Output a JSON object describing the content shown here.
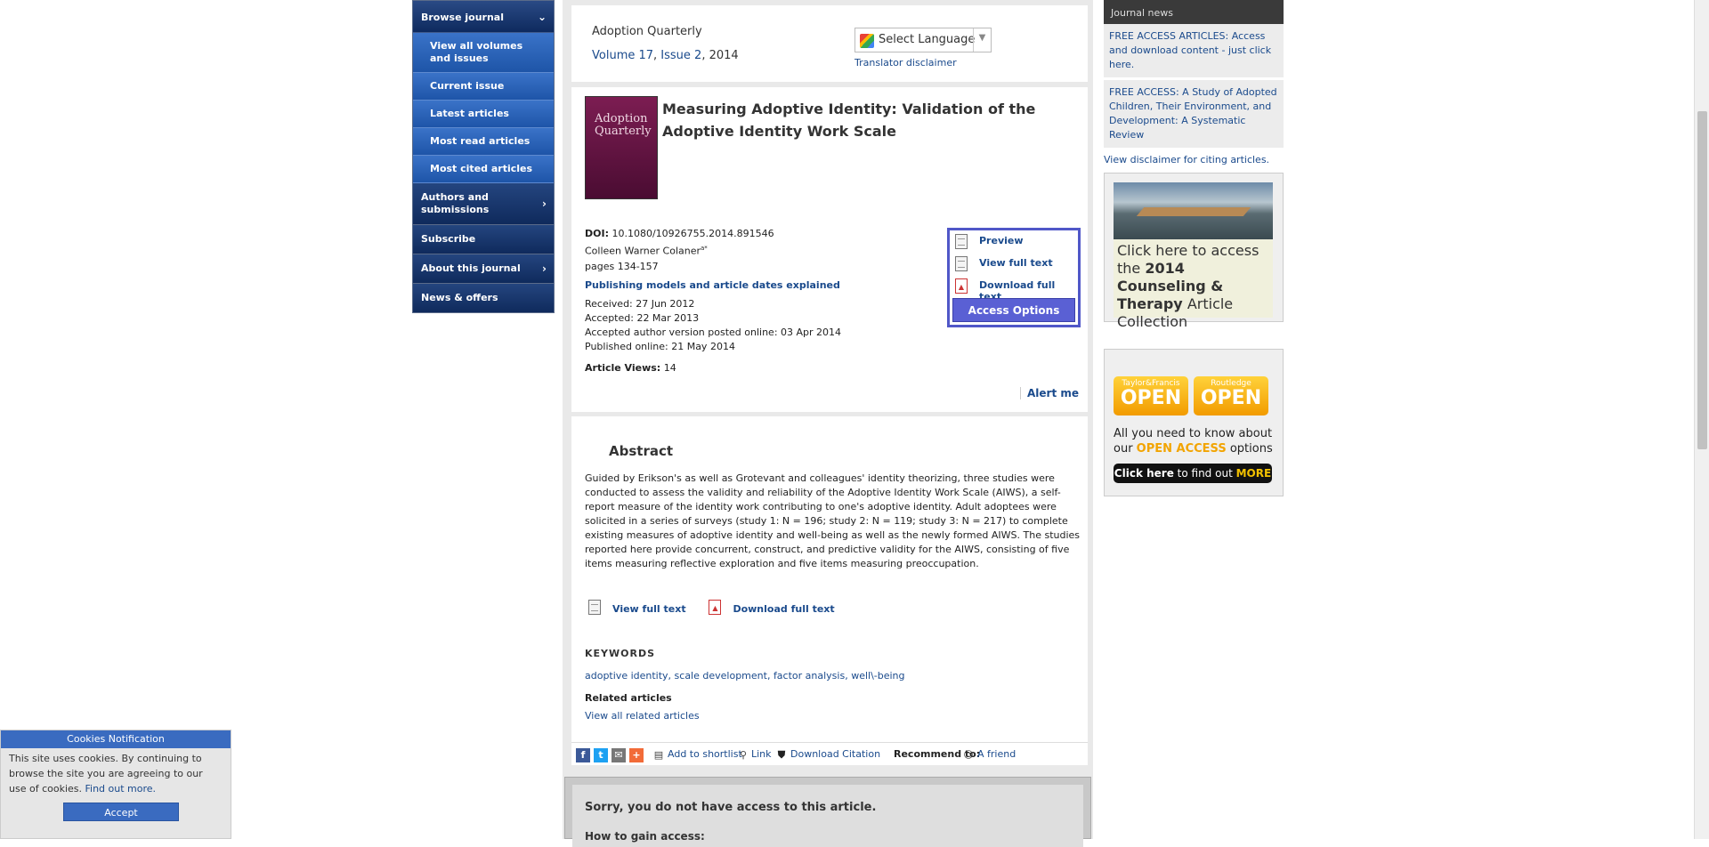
{
  "nav": {
    "browse": "Browse journal",
    "sub": [
      "View all volumes and issues",
      "Current issue",
      "Latest articles",
      "Most read articles",
      "Most cited articles"
    ],
    "authors": "Authors and submissions",
    "subscribe": "Subscribe",
    "about": "About this journal",
    "news": "News & offers"
  },
  "header": {
    "journal": "Adoption Quarterly",
    "volume": "Volume 17",
    "issue": "Issue 2",
    "year": "2014",
    "language": "Select Language",
    "disclaimer": "Translator disclaimer"
  },
  "article": {
    "cover_text": "Adoption Quarterly",
    "title": "Measuring Adoptive Identity: Validation of the Adoptive Identity Work Scale",
    "doi_label": "DOI:",
    "doi": "10.1080/10926755.2014.891546",
    "author": "Colleen Warner Colaner",
    "author_mark": "a*",
    "pages": "pages 134-157",
    "pub_models": "Publishing models and article dates explained",
    "received": "Received: 27 Jun 2012",
    "accepted": "Accepted: 22 Mar 2013",
    "posted": "Accepted author version posted online: 03 Apr 2014",
    "published": "Published online: 21 May 2014",
    "views_label": "Article Views:",
    "views": "14",
    "alert": "Alert me"
  },
  "access": {
    "preview": "Preview",
    "view": "View full text",
    "download": "Download full text",
    "options": "Access Options"
  },
  "abstract": {
    "heading": "Abstract",
    "text": "Guided by Erikson's as well as Grotevant and colleagues' identity theorizing, three studies were conducted to assess the validity and reliability of the Adoptive Identity Work Scale (AIWS), a self-report measure of the identity work contributing to one's adoptive identity. Adult adoptees were solicited in a series of surveys (study 1: N = 196; study 2: N = 119; study 3: N = 217) to complete existing measures of adoptive identity and well-being as well as the newly formed AIWS. The studies reported here provide concurrent, construct, and predictive validity for the AIWS, consisting of five items measuring reflective exploration and five items measuring preoccupation.",
    "view": "View full text",
    "download": "Download full text",
    "keywords_heading": "KEYWORDS",
    "keywords": "adoptive identity, scale development, factor analysis, well\\-being",
    "related_heading": "Related articles",
    "related_link": "View all related articles"
  },
  "share": {
    "shortlist": "Add to shortlist",
    "link": "Link",
    "citation": "Download Citation",
    "recommend": "Recommend to:",
    "friend": "A friend"
  },
  "noaccess": {
    "title": "Sorry, you do not have access to this article.",
    "sub": "How to gain access:"
  },
  "right": {
    "news_heading": "Journal news",
    "news": [
      "FREE ACCESS ARTICLES: Access and download content - just click here.",
      "FREE ACCESS: A Study of Adopted Children, Their Environment, and Development: A Systematic Review"
    ],
    "cite": "View disclaimer for citing articles.",
    "ad1_a": "Click here to access the ",
    "ad1_b": "2014 Counseling & Therapy",
    "ad1_c": " Article Collection",
    "oa1_small": "Taylor&Francis",
    "oa1_big": "OPEN",
    "oa2_small": "Routledge",
    "oa2_big": "OPEN",
    "ad2_a": "All you need to know about our ",
    "ad2_b": "OPEN ACCESS",
    "ad2_c": " options",
    "ad2_btn_a": "Click here",
    "ad2_btn_b": " to find out ",
    "ad2_btn_c": "MORE"
  },
  "cookie": {
    "heading": "Cookies Notification",
    "text": "This site uses cookies. By continuing to browse the site you are agreeing to our use of cookies. ",
    "link": "Find out more.",
    "accept": "Accept"
  }
}
